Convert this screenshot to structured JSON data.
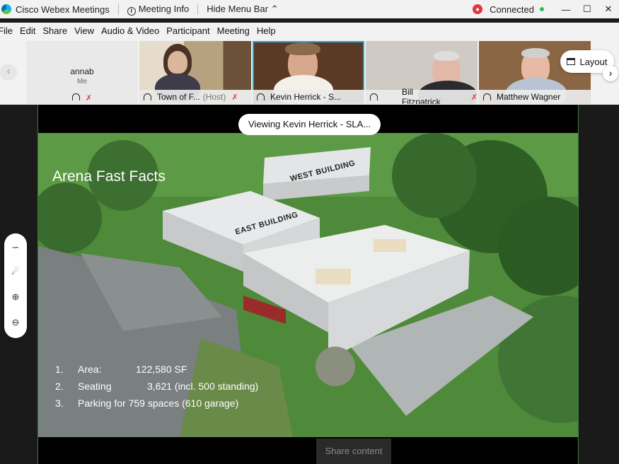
{
  "titlebar": {
    "app_title": "Cisco Webex Meetings",
    "meeting_info": "Meeting Info",
    "hide_menu": "Hide Menu Bar",
    "connection": "Connected"
  },
  "menu": [
    "File",
    "Edit",
    "Share",
    "View",
    "Audio & Video",
    "Participant",
    "Meeting",
    "Help"
  ],
  "participants": [
    {
      "name": "annab",
      "sub": "Me"
    },
    {
      "name": "Town of F...",
      "host": "(Host)"
    },
    {
      "name": "Kevin Herrick - S..."
    },
    {
      "name": "Bill Fitzpatrick"
    },
    {
      "name": "Matthew Wagner"
    }
  ],
  "layout_label": "Layout",
  "viewing_label": "Viewing Kevin Herrick - SLA...",
  "slide": {
    "title": "Arena Fast Facts",
    "west_building": "WEST BUILDING",
    "east_building": "EAST BUILDING",
    "facts": [
      {
        "num": "1.",
        "label": "Area:",
        "value": "122,580 SF"
      },
      {
        "num": "2.",
        "label": "Seating",
        "value": "3,621 (incl. 500 standing)"
      },
      {
        "num": "3.",
        "label": "Parking for 759 spaces (610 garage)",
        "value": ""
      }
    ]
  },
  "share_content": "Share content",
  "colors": {
    "accent": "#1fa9d6",
    "connected": "#2ebd59",
    "muted": "#e0393e"
  }
}
